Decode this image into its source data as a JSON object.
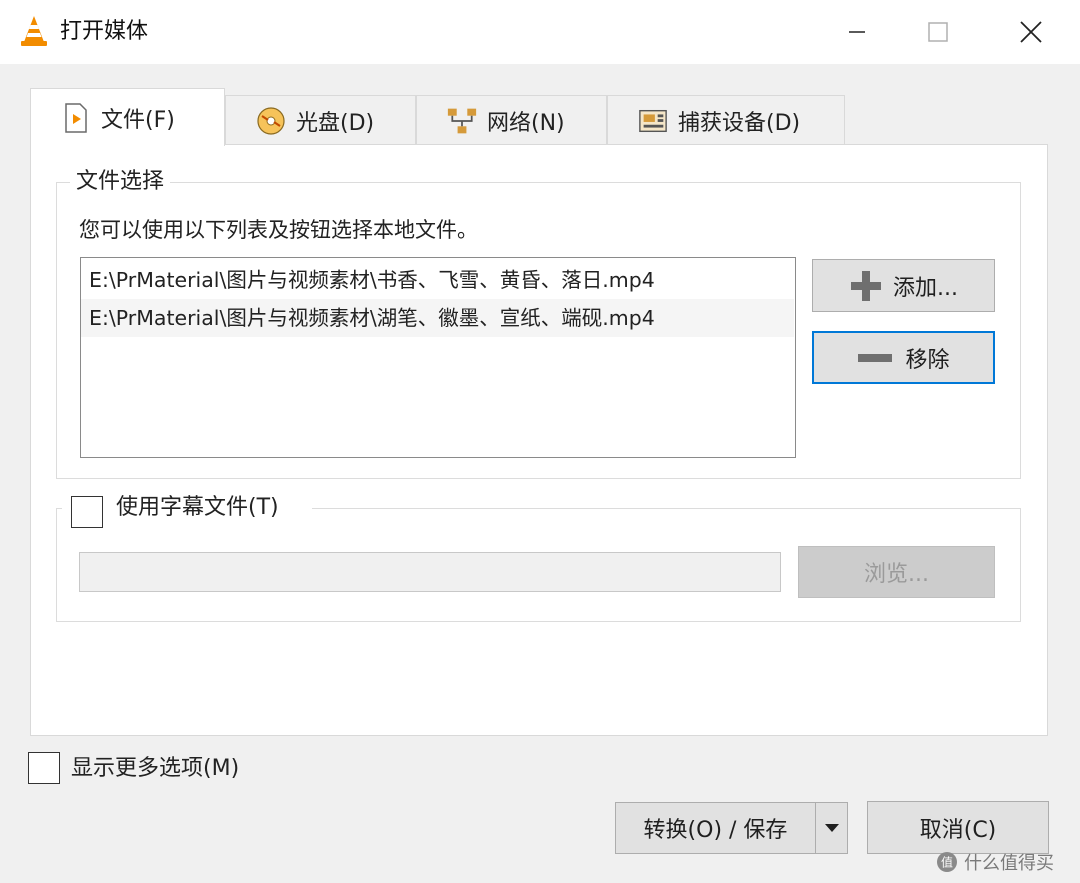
{
  "window": {
    "title": "打开媒体"
  },
  "tabs": [
    {
      "label": "文件(F)",
      "icon": "file-icon",
      "active": true
    },
    {
      "label": "光盘(D)",
      "icon": "disc-icon",
      "active": false
    },
    {
      "label": "网络(N)",
      "icon": "network-icon",
      "active": false
    },
    {
      "label": "捕获设备(D)",
      "icon": "capture-device-icon",
      "active": false
    }
  ],
  "file_selection": {
    "legend": "文件选择",
    "description": "您可以使用以下列表及按钮选择本地文件。",
    "files": [
      "E:\\PrMaterial\\图片与视频素材\\书香、飞雪、黄昏、落日.mp4",
      "E:\\PrMaterial\\图片与视频素材\\湖笔、徽墨、宣纸、端砚.mp4"
    ],
    "add_label": "添加...",
    "remove_label": "移除"
  },
  "subtitle": {
    "checkbox_label": "使用字幕文件(T)",
    "browse_label": "浏览..."
  },
  "more_options_label": "显示更多选项(M)",
  "footer": {
    "convert_save_label": "转换(O) / 保存",
    "cancel_label": "取消(C)"
  },
  "watermark": "什么值得买",
  "colors": {
    "client_bg": "#f0f0f0",
    "focus_border": "#0078d7",
    "vlc_orange": "#f28c00"
  }
}
